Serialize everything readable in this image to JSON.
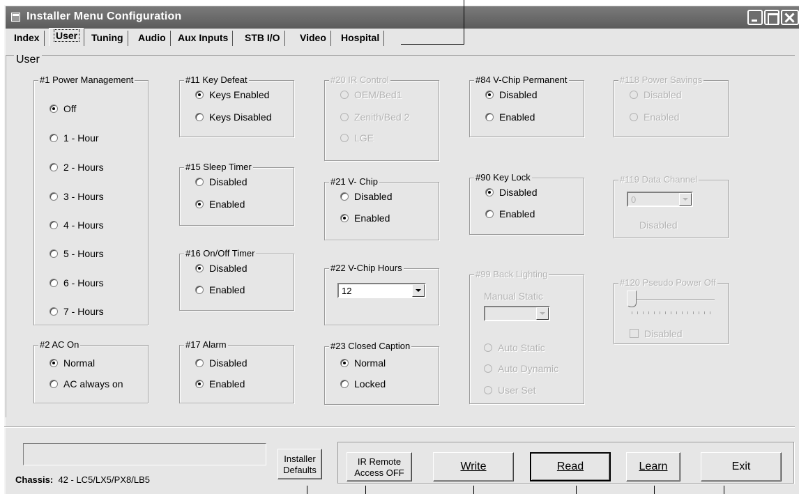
{
  "window": {
    "title": "Installer Menu Configuration"
  },
  "tabs": [
    {
      "label": "Index"
    },
    {
      "label": "User"
    },
    {
      "label": "Tuning"
    },
    {
      "label": "Audio"
    },
    {
      "label": "Aux Inputs"
    },
    {
      "label": "STB I/O"
    },
    {
      "label": "Video"
    },
    {
      "label": "Hospital"
    }
  ],
  "active_tab": "User",
  "panel": {
    "title": "User"
  },
  "groups": {
    "power_mgmt": {
      "title": "#1 Power Management",
      "options": [
        "Off",
        "1 - Hour",
        "2 - Hours",
        "3 - Hours",
        "4 - Hours",
        "5 - Hours",
        "6 - Hours",
        "7 - Hours"
      ],
      "selected": "Off"
    },
    "ac_on": {
      "title": "#2 AC On",
      "options": [
        "Normal",
        "AC always on"
      ],
      "selected": "Normal"
    },
    "key_defeat": {
      "title": "#11 Key Defeat",
      "options": [
        "Keys Enabled",
        "Keys Disabled"
      ],
      "selected": "Keys Enabled"
    },
    "sleep_timer": {
      "title": "#15 Sleep Timer",
      "options": [
        "Disabled",
        "Enabled"
      ],
      "selected": "Enabled"
    },
    "onoff_timer": {
      "title": "#16 On/Off Timer",
      "options": [
        "Disabled",
        "Enabled"
      ],
      "selected": "Disabled"
    },
    "alarm": {
      "title": "#17 Alarm",
      "options": [
        "Disabled",
        "Enabled"
      ],
      "selected": "Enabled"
    },
    "ir_control": {
      "title": "#20 IR Control",
      "options": [
        "OEM/Bed1",
        "Zenith/Bed 2",
        "LGE"
      ],
      "enabled": false
    },
    "vchip": {
      "title": "#21 V- Chip",
      "options": [
        "Disabled",
        "Enabled"
      ],
      "selected": "Enabled"
    },
    "vchip_hours": {
      "title": "#22 V-Chip Hours",
      "value": "12"
    },
    "closed_caption": {
      "title": "#23 Closed Caption",
      "options": [
        "Normal",
        "Locked"
      ],
      "selected": "Normal"
    },
    "vchip_perm": {
      "title": "#84 V-Chip Permanent",
      "options": [
        "Disabled",
        "Enabled"
      ],
      "selected": "Disabled"
    },
    "key_lock": {
      "title": "#90 Key Lock",
      "options": [
        "Disabled",
        "Enabled"
      ],
      "selected": "Disabled"
    },
    "back_lighting": {
      "title": "#99 Back Lighting",
      "static_label": "Manual Static",
      "value": "",
      "options": [
        "Auto Static",
        "Auto Dynamic",
        "User Set"
      ],
      "enabled": false
    },
    "power_savings": {
      "title": "#118 Power Savings",
      "options": [
        "Disabled",
        "Enabled"
      ],
      "enabled": false
    },
    "data_channel": {
      "title": "#119 Data Channel",
      "value": "0",
      "status": "Disabled",
      "enabled": false
    },
    "pseudo_power_off": {
      "title": "#120 Pseudo Power Off",
      "checkbox_label": "Disabled",
      "checked": false,
      "slider_level": 0,
      "enabled": false
    }
  },
  "footer": {
    "status_text": "",
    "chassis_label": "Chassis:",
    "chassis_value": "42 - LC5/LX5/PX8/LB5",
    "buttons": {
      "installer_defaults": [
        "Installer",
        "Defaults"
      ],
      "ir_remote": [
        "IR Remote",
        "Access OFF"
      ],
      "write": "Write",
      "read": "Read",
      "learn": "Learn",
      "exit": "Exit"
    }
  }
}
